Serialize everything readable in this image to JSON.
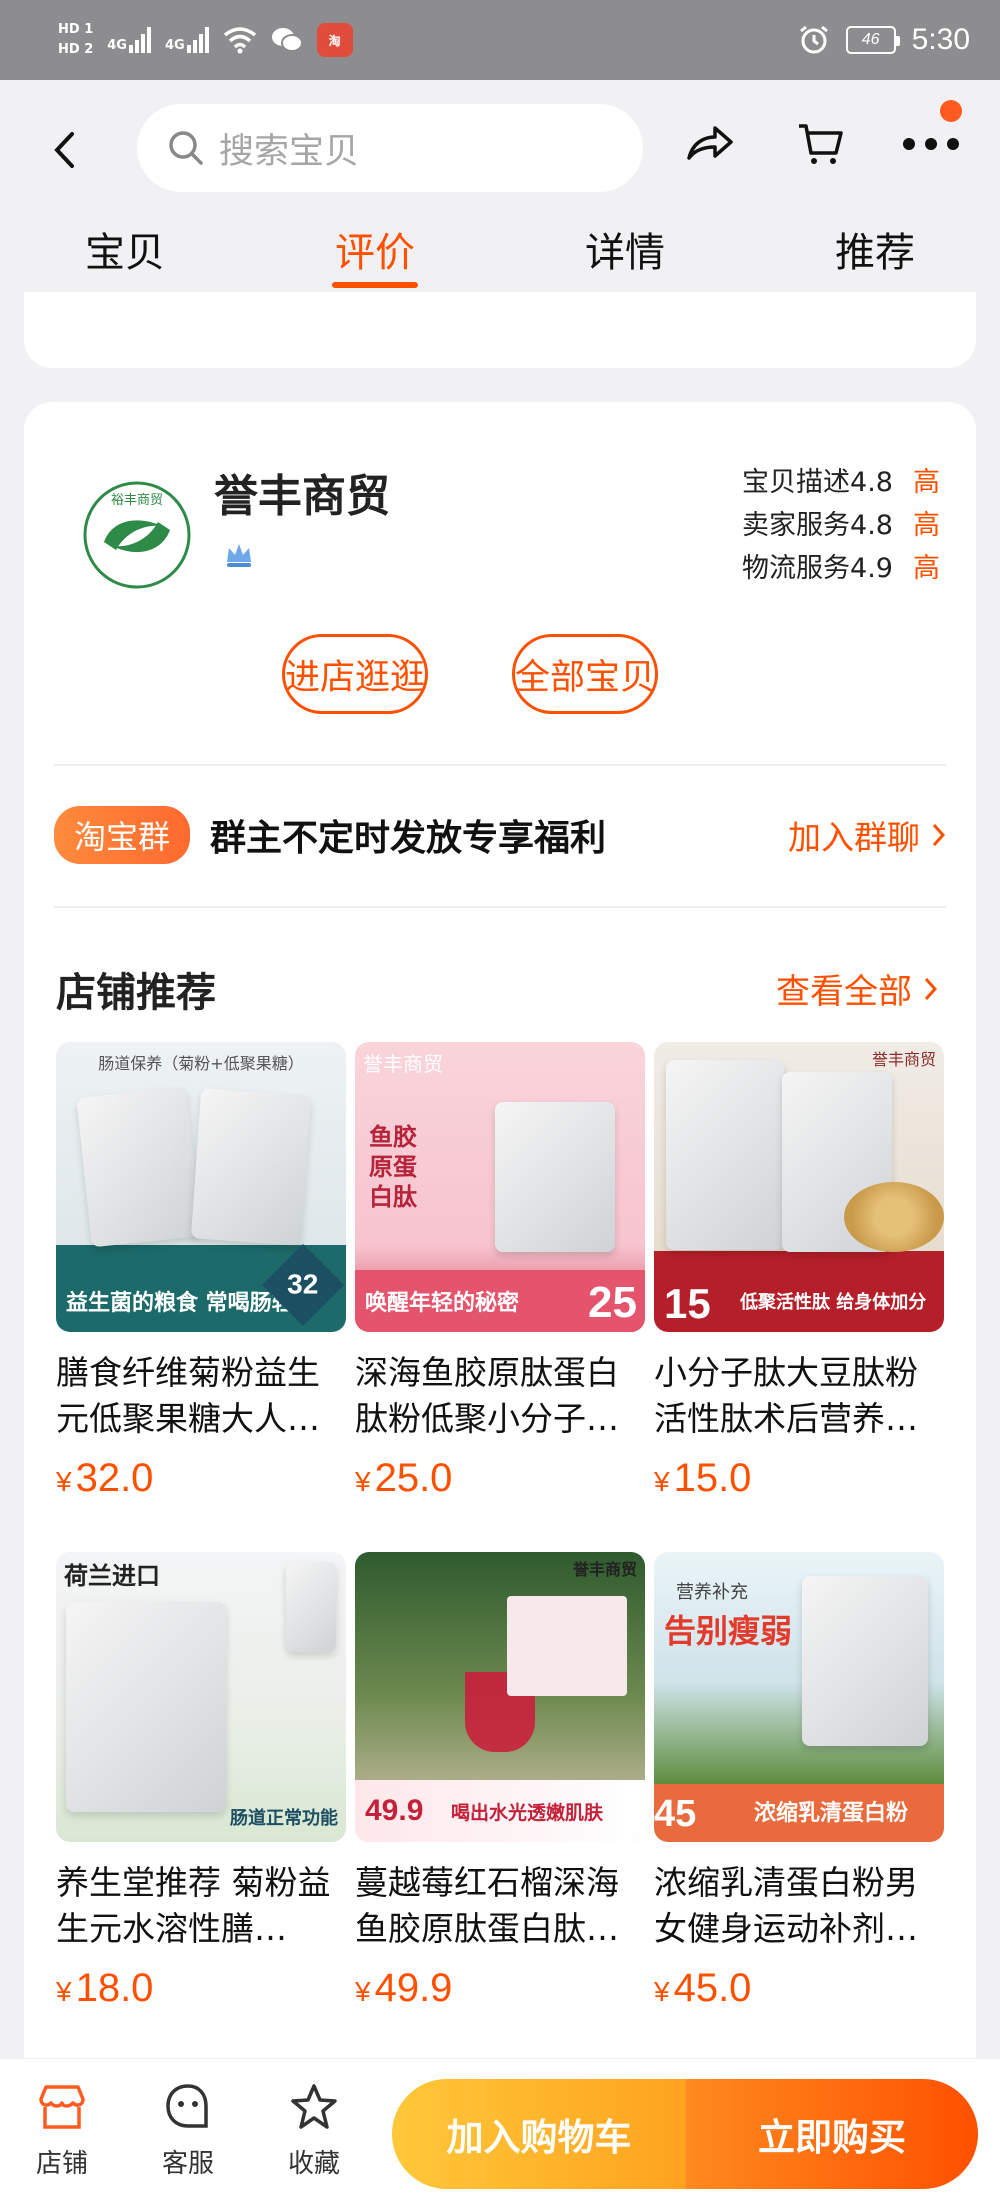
{
  "status_bar": {
    "hd1": "HD 1",
    "hd2": "HD 2",
    "net1": "4G",
    "net2": "4G",
    "app_icon_label": "淘",
    "battery": "46",
    "time": "5:30"
  },
  "header": {
    "search_placeholder": "搜索宝贝",
    "tabs": [
      {
        "label": "宝贝",
        "active": false
      },
      {
        "label": "评价",
        "active": true
      },
      {
        "label": "详情",
        "active": false
      },
      {
        "label": "推荐",
        "active": false
      }
    ]
  },
  "shop": {
    "name": "誉丰商贸",
    "logo_text": "裕丰商贸",
    "ratings": [
      {
        "label": "宝贝描述",
        "score": "4.8",
        "level": "高"
      },
      {
        "label": "卖家服务",
        "score": "4.8",
        "level": "高"
      },
      {
        "label": "物流服务",
        "score": "4.9",
        "level": "高"
      }
    ],
    "enter_store_label": "进店逛逛",
    "all_items_label": "全部宝贝",
    "group": {
      "tag": "淘宝群",
      "text": "群主不定时发放专享福利",
      "link": "加入群聊"
    },
    "recommend": {
      "title": "店铺推荐",
      "more": "查看全部"
    },
    "products": [
      {
        "name": "膳食纤维菊粉益生元低聚果糖大人…",
        "price_symbol": "¥",
        "price": "32.0",
        "img_top": "肠道保养（菊粉+低聚果糖）",
        "img_caption": "益生菌的粮食 常喝肠轻松",
        "img_badge": "32"
      },
      {
        "name": "深海鱼胶原肽蛋白肽粉低聚小分子…",
        "price_symbol": "¥",
        "price": "25.0",
        "img_top": "誉丰商贸",
        "img_caption": "唤醒年轻的秘密",
        "img_badge": "25",
        "img_title": "鱼胶原蛋白肽"
      },
      {
        "name": "小分子肽大豆肽粉活性肽术后营养…",
        "price_symbol": "¥",
        "price": "15.0",
        "img_top": "誉丰商贸",
        "img_caption": "低聚活性肽 给身体加分",
        "img_badge": "15"
      },
      {
        "name": "养生堂推荐 菊粉益生元水溶性膳…",
        "price_symbol": "¥",
        "price": "18.0",
        "img_top": "荷兰进口",
        "img_caption": "肠道正常功能"
      },
      {
        "name": "蔓越莓红石榴深海鱼胶原肽蛋白肽…",
        "price_symbol": "¥",
        "price": "49.9",
        "img_top": "誉丰商贸",
        "img_caption": "喝出水光透嫩肌肤",
        "img_badge": "49.9"
      },
      {
        "name": "浓缩乳清蛋白粉男女健身运动补剂…",
        "price_symbol": "¥",
        "price": "45.0",
        "img_top": "营养补充",
        "img_caption": "浓缩乳清蛋白粉",
        "img_badge": "45",
        "img_title": "告别瘦弱"
      }
    ]
  },
  "bottom_bar": {
    "store_label": "店铺",
    "service_label": "客服",
    "favorite_label": "收藏",
    "add_cart_label": "加入购物车",
    "buy_now_label": "立即购买"
  },
  "colors": {
    "accent": "#ff5000",
    "status_bar": "#8d8d8f",
    "page_bg": "#f1f1f3"
  }
}
